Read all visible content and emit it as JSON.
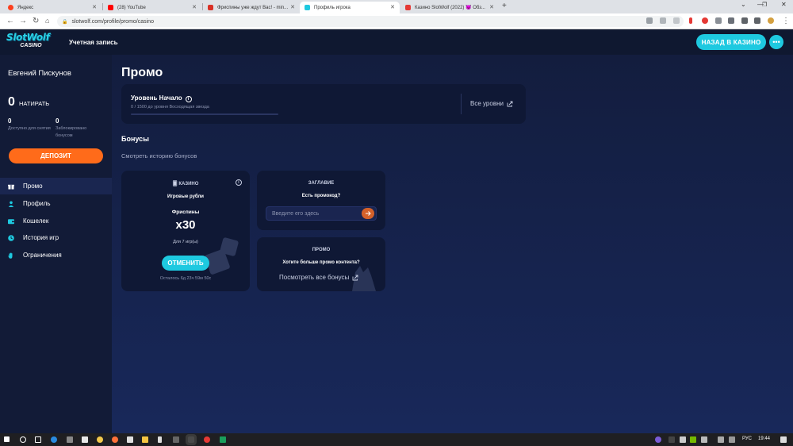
{
  "browser": {
    "tabs": [
      {
        "label": "Яндекс",
        "color": "#fc3f1d"
      },
      {
        "label": "(28) YouTube",
        "color": "#ff0000"
      },
      {
        "label": "Фриспины уже ждут Вас! - min...",
        "color": "#d93025"
      },
      {
        "label": "Профиль игрока",
        "color": "#1ec9e0"
      },
      {
        "label": "Казино SlotWolf (2022) 😈 Обз...",
        "color": "#e53935"
      }
    ],
    "url": "slotwolf.com/profile/promo/casino"
  },
  "header": {
    "logo_top": "SlotWolf",
    "logo_bottom": "CASINO",
    "account_label": "Учетная запись",
    "back_label": "НАЗАД В КАЗИНО",
    "more_label": "•••"
  },
  "sidebar": {
    "username": "Евгений Пискунов",
    "balance": "0",
    "currency": "НАТИРАТЬ",
    "available_value": "0",
    "available_label": "Доступно для снятия",
    "blocked_value": "0",
    "blocked_label": "Заблокировано бонусом",
    "deposit_label": "ДЕПОЗИТ",
    "menu": [
      {
        "label": "Промо",
        "icon": "gift-icon"
      },
      {
        "label": "Профиль",
        "icon": "user-icon"
      },
      {
        "label": "Кошелек",
        "icon": "wallet-icon"
      },
      {
        "label": "История игр",
        "icon": "history-icon"
      },
      {
        "label": "Ограничения",
        "icon": "hand-icon"
      }
    ]
  },
  "main": {
    "title": "Промо",
    "level": {
      "title": "Уровень Начало",
      "subtitle": "0 / 1500 до уровня Восходящая звезда",
      "progress": 0,
      "all_levels": "Все уровни"
    },
    "bonuses_title": "Бонусы",
    "bonus_history": "Смотреть историю бонусов",
    "casino_card": {
      "tag": "КАЗИНО",
      "currency_line": "Игровые рубли",
      "type_line": "Фриспины",
      "multiplier": "x30",
      "games_line": "Для 7 игр(ы)",
      "cancel_label": "ОТМЕНИТЬ",
      "remaining": "Осталось 6д 23ч 59м 50с"
    },
    "promo_code": {
      "title": "ЗАГЛАВИЕ",
      "question": "Есть промокод?",
      "placeholder": "Введите его здесь"
    },
    "more_promo": {
      "title": "ПРОМО",
      "question": "Хотите больше промо контента?",
      "link": "Посмотреть все бонусы"
    }
  },
  "taskbar": {
    "lang": "РУС",
    "time": "19:44"
  }
}
